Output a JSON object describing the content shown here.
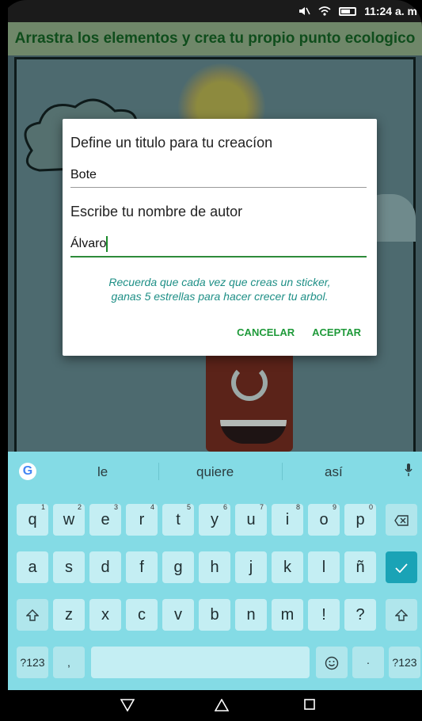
{
  "status_bar": {
    "time": "11:24 a. m"
  },
  "app": {
    "title": "Arrastra los elementos y crea tu propio punto ecologico"
  },
  "dialog": {
    "title_label": "Define un titulo para tu creacíon",
    "title_value": "Bote",
    "author_label": "Escribe tu nombre de autor",
    "author_value": "Álvaro",
    "note_line1": "Recuerda que cada vez que creas un sticker,",
    "note_line2": "ganas 5 estrellas para hacer crecer tu arbol.",
    "cancel": "CANCELAR",
    "accept": "ACEPTAR"
  },
  "keyboard": {
    "suggestions": [
      "le",
      "quiere",
      "así"
    ],
    "row1": [
      {
        "key": "q",
        "hint": "1"
      },
      {
        "key": "w",
        "hint": "2"
      },
      {
        "key": "e",
        "hint": "3"
      },
      {
        "key": "r",
        "hint": "4"
      },
      {
        "key": "t",
        "hint": "5"
      },
      {
        "key": "y",
        "hint": "6"
      },
      {
        "key": "u",
        "hint": "7"
      },
      {
        "key": "i",
        "hint": "8"
      },
      {
        "key": "o",
        "hint": "9"
      },
      {
        "key": "p",
        "hint": "0"
      }
    ],
    "row2": [
      "a",
      "s",
      "d",
      "f",
      "g",
      "h",
      "j",
      "k",
      "l",
      "ñ"
    ],
    "row3": [
      "z",
      "x",
      "c",
      "v",
      "b",
      "n",
      "m",
      "!",
      "?"
    ],
    "symbols_label": "?123",
    "comma": ",",
    "period": "·",
    "accent_color": "#1aa3b6"
  },
  "icons": {
    "backspace": "backspace-icon",
    "enter": "check-icon",
    "shift": "shift-icon",
    "emoji": "emoji-icon",
    "mic": "mic-icon"
  }
}
